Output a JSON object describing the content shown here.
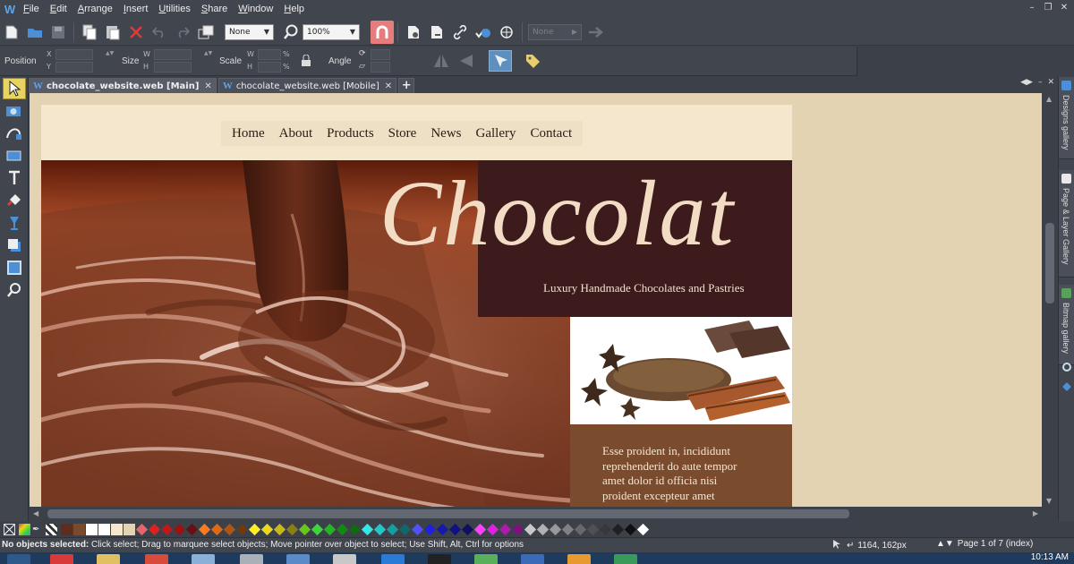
{
  "menubar": {
    "items": [
      "File",
      "Edit",
      "Arrange",
      "Insert",
      "Utilities",
      "Share",
      "Window",
      "Help"
    ]
  },
  "toolbar": {
    "snap_combo": "None",
    "zoom_combo": "100%",
    "disabled_combo": "None"
  },
  "infobar": {
    "position_label": "Position",
    "size_label": "Size",
    "scale_label": "Scale",
    "angle_label": "Angle",
    "x_label": "X",
    "y_label": "Y",
    "w_label": "W",
    "h_label": "H",
    "percent": "%"
  },
  "tabs": [
    {
      "label": "chocolate_website.web [Main]",
      "active": true
    },
    {
      "label": "chocolate_website.web [Mobile]",
      "active": false
    }
  ],
  "right_panel": {
    "tabs": [
      "Designs gallery",
      "Page & Layer Gallery",
      "Bitmap gallery"
    ]
  },
  "website": {
    "nav": [
      "Home",
      "About",
      "Products",
      "Store",
      "News",
      "Gallery",
      "Contact"
    ],
    "title": "Chocolat",
    "subtitle": "Luxury Handmade Chocolates and Pastries",
    "body_lines": [
      "Esse proident in, incididunt",
      "reprehenderit do aute tempor",
      "amet dolor id officia nisi",
      "proident excepteur amet"
    ]
  },
  "palette": {
    "colors": [
      "#5c2e1f",
      "#7a4a2a",
      "#ffffff",
      "#ffffff",
      "#f5e7cd",
      "#e4d3b2",
      "#e8646a",
      "#e02020",
      "#c01818",
      "#a01010",
      "#6a1010",
      "#ff7a1a",
      "#e06a10",
      "#b05510",
      "#6a3a10",
      "#ffee20",
      "#e8d818",
      "#c8b818",
      "#8a8010",
      "#64c818",
      "#38d838",
      "#20b820",
      "#108a10",
      "#106a10",
      "#30e8e8",
      "#20c8c8",
      "#10a0a0",
      "#106868",
      "#5050ff",
      "#2020e0",
      "#1818b0",
      "#101088",
      "#101060",
      "#ff40ff",
      "#e020e0",
      "#b018b0",
      "#801080",
      "#c8c8c8",
      "#b0b0b0",
      "#989898",
      "#808080",
      "#686868",
      "#505050",
      "#383838",
      "#202020",
      "#101010",
      "#ffffff"
    ]
  },
  "status": {
    "bold": "No objects selected:",
    "message": " Click select; Drag to marquee select objects; Move pointer over object to select; Use Shift, Alt, Ctrl for options",
    "coords": "1164, 162px",
    "page": "Page 1 of 7 (index)"
  },
  "taskbar": {
    "clock": "10:13 AM"
  },
  "colors": {
    "accent": "#5fa3e8",
    "tool_active": "#e8d260",
    "title_box": "#3d1a1b",
    "text_box": "#7b4b2e",
    "page_bg": "#f5e7cd"
  }
}
